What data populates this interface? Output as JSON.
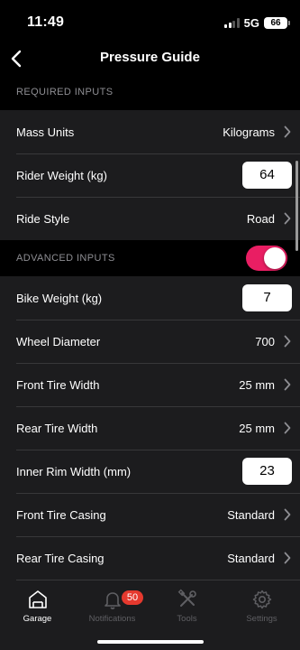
{
  "status_bar": {
    "time": "11:49",
    "network": "5G",
    "battery": "66"
  },
  "header": {
    "title": "Pressure Guide"
  },
  "sections": {
    "required": {
      "title": "REQUIRED INPUTS",
      "rows": {
        "mass_units": {
          "label": "Mass Units",
          "value": "Kilograms"
        },
        "rider_weight": {
          "label": "Rider Weight (kg)",
          "value": "64"
        },
        "ride_style": {
          "label": "Ride Style",
          "value": "Road"
        }
      }
    },
    "advanced": {
      "title": "ADVANCED INPUTS",
      "toggle_on": true,
      "rows": {
        "bike_weight": {
          "label": "Bike Weight (kg)",
          "value": "7"
        },
        "wheel_diameter": {
          "label": "Wheel Diameter",
          "value": "700"
        },
        "front_tire_width": {
          "label": "Front Tire Width",
          "value": "25 mm"
        },
        "rear_tire_width": {
          "label": "Rear Tire Width",
          "value": "25 mm"
        },
        "inner_rim_width": {
          "label": "Inner Rim Width (mm)",
          "value": "23"
        },
        "front_tire_casing": {
          "label": "Front Tire Casing",
          "value": "Standard"
        },
        "rear_tire_casing": {
          "label": "Rear Tire Casing",
          "value": "Standard"
        }
      }
    }
  },
  "tab_bar": {
    "tabs": [
      {
        "label": "Garage",
        "icon": "garage-icon",
        "active": true
      },
      {
        "label": "Notifications",
        "icon": "bell-icon",
        "badge": "50"
      },
      {
        "label": "Tools",
        "icon": "tools-icon"
      },
      {
        "label": "Settings",
        "icon": "gear-icon"
      }
    ]
  },
  "colors": {
    "accent_toggle": "#e91e63",
    "badge": "#e5392e",
    "row_bg": "#1c1c1e",
    "background": "#000000"
  }
}
